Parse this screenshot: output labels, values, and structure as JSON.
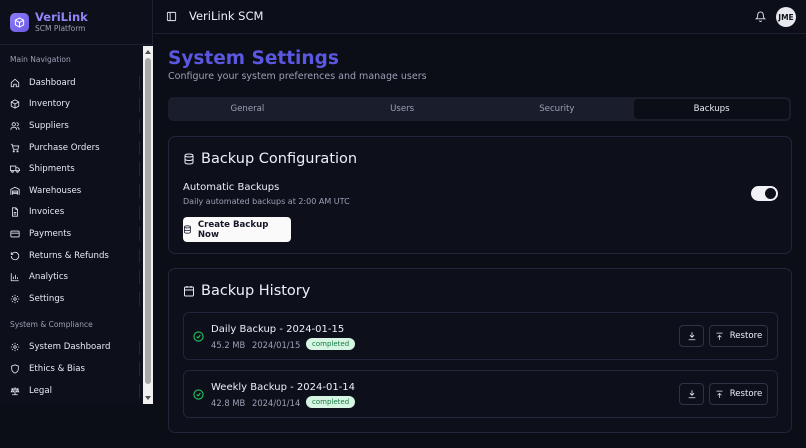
{
  "brand": {
    "name": "VeriLink",
    "subtitle": "SCM Platform"
  },
  "sidebar": {
    "main_section_label": "Main Navigation",
    "main_items": [
      {
        "label": "Dashboard",
        "icon": "home-icon"
      },
      {
        "label": "Inventory",
        "icon": "package-icon"
      },
      {
        "label": "Suppliers",
        "icon": "users-icon"
      },
      {
        "label": "Purchase Orders",
        "icon": "cart-icon"
      },
      {
        "label": "Shipments",
        "icon": "truck-icon"
      },
      {
        "label": "Warehouses",
        "icon": "warehouse-icon"
      },
      {
        "label": "Invoices",
        "icon": "file-icon"
      },
      {
        "label": "Payments",
        "icon": "card-icon"
      },
      {
        "label": "Returns & Refunds",
        "icon": "rotate-icon"
      },
      {
        "label": "Analytics",
        "icon": "chart-icon"
      },
      {
        "label": "Settings",
        "icon": "gear-icon"
      }
    ],
    "system_section_label": "System & Compliance",
    "system_items": [
      {
        "label": "System Dashboard",
        "icon": "gear-icon"
      },
      {
        "label": "Ethics & Bias",
        "icon": "shield-icon"
      },
      {
        "label": "Legal",
        "icon": "scale-icon"
      }
    ]
  },
  "header": {
    "title": "VeriLink SCM",
    "avatar_initials": "JME"
  },
  "page": {
    "title": "System Settings",
    "subtitle": "Configure your system preferences and manage users",
    "tabs": [
      {
        "label": "General",
        "active": false
      },
      {
        "label": "Users",
        "active": false
      },
      {
        "label": "Security",
        "active": false
      },
      {
        "label": "Backups",
        "active": true
      }
    ]
  },
  "backup_config": {
    "title": "Backup Configuration",
    "auto_label": "Automatic Backups",
    "auto_desc": "Daily automated backups at 2:00 AM UTC",
    "auto_enabled": true,
    "create_button": "Create Backup Now"
  },
  "backup_history": {
    "title": "Backup History",
    "restore_label": "Restore",
    "items": [
      {
        "name": "Daily Backup - 2024-01-15",
        "size": "45.2 MB",
        "date": "2024/01/15",
        "status": "completed"
      },
      {
        "name": "Weekly Backup - 2024-01-14",
        "size": "42.8 MB",
        "date": "2024/01/14",
        "status": "completed"
      }
    ]
  },
  "colors": {
    "accent": "#5b57e0",
    "brand": "#8f86f6",
    "success": "#22c55e",
    "background": "#0b0d17"
  }
}
